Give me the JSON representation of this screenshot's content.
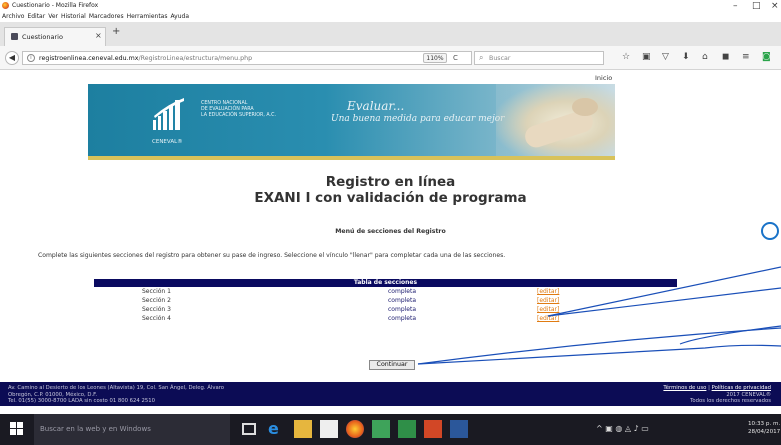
{
  "window": {
    "title": "Cuestionario - Mozilla Firefox",
    "controls": [
      "–",
      "□",
      "×"
    ]
  },
  "menubar": [
    "Archivo",
    "Editar",
    "Ver",
    "Historial",
    "Marcadores",
    "Herramientas",
    "Ayuda"
  ],
  "tab": {
    "label": "Cuestionario",
    "close": "×",
    "new_tab": "+"
  },
  "navbar": {
    "url_host": "registroenlinea.ceneval.edu.mx",
    "url_path": "/RegistroLinea/estructura/menu.php",
    "zoom": "110%",
    "reload": "C",
    "search_placeholder": "Buscar"
  },
  "page": {
    "inicio_link": "Inicio",
    "banner": {
      "institution": [
        "CENTRO NACIONAL",
        "DE EVALUACIÓN PARA",
        "LA EDUCACIÓN SUPERIOR, A.C."
      ],
      "logo_caption": "CENEVAL®",
      "slogan_line1": "Evaluar...",
      "slogan_line2": "Una buena medida para educar mejor"
    },
    "title_line1": "Registro en línea",
    "title_line2": "EXANI I con validación de programa",
    "menu_title": "Menú de secciones del Registro",
    "instructions": "Complete las siguientes secciones del registro para obtener su pase de ingreso. Seleccione el vínculo \"llenar\" para completar cada una de las secciones.",
    "table": {
      "header": "Tabla de secciones",
      "rows": [
        {
          "section": "Sección 1",
          "status": "completa",
          "action": "[editar]"
        },
        {
          "section": "Sección 2",
          "status": "completa",
          "action": "[editar]"
        },
        {
          "section": "Sección 3",
          "status": "completa",
          "action": "[editar]"
        },
        {
          "section": "Sección 4",
          "status": "completa",
          "action": "[editar]"
        }
      ]
    },
    "continue_button": "Continuar"
  },
  "footer": {
    "address_line1": "Av. Camino al Desierto de los Leones (Altavista) 19, Col. San Ángel, Deleg. Álvaro",
    "address_line2": "Obregón, C.P. 01000, México, D.F.",
    "address_line3": "Tel. 01(55) 3000-8700 LADA sin costo 01 800 624 2510",
    "terms_link": "Términos de uso",
    "separator": "|",
    "privacy_link": "Políticas de privacidad",
    "copyright": "2017 CENEVAL®",
    "rights": "Todos los derechos reservados"
  },
  "taskbar": {
    "search_placeholder": "Buscar en la web y en Windows",
    "time": "10:33 p. m.",
    "date": "28/04/2017"
  },
  "colors": {
    "table_header_bg": "#0a0a60",
    "footer_bg": "#0c0c55",
    "status_text": "#1a1a6e",
    "edit_link": "#e07b12",
    "annotation": "#1a73c8"
  }
}
